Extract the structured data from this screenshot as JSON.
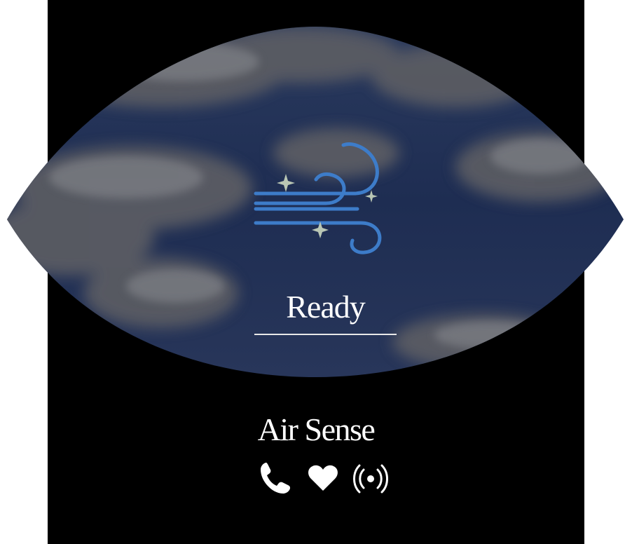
{
  "status": {
    "label": "Ready"
  },
  "app": {
    "title": "Air Sense"
  },
  "icons": {
    "main": "wind-sparkle-icon",
    "actions": [
      "phone-icon",
      "heart-icon",
      "broadcast-icon"
    ]
  },
  "colors": {
    "wind_stroke": "#3d7cc9",
    "sparkle": "#b9c6b4",
    "sky": "#1f2f55",
    "text": "#ffffff"
  }
}
